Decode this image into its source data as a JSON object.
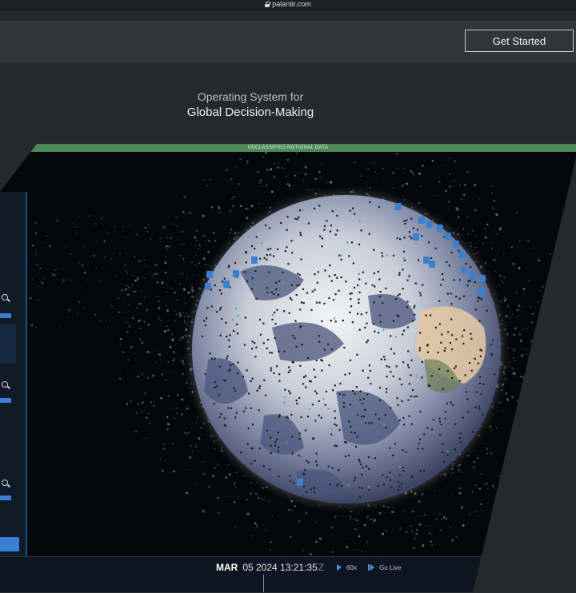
{
  "browser": {
    "url": "palantir.com",
    "lock_icon": "lock-icon"
  },
  "header": {
    "cta_label": "Get Started"
  },
  "hero": {
    "tagline_line1": "Operating System for",
    "tagline_line2": "Global Decision-Making"
  },
  "screen": {
    "classification": "UNCLASSIFIED NOTIONAL DATA",
    "classification_color": "#4f8a5a",
    "time": {
      "month": "MAR",
      "rest": "05 2024 13:21:35",
      "zone": "Z",
      "speed": "60x",
      "live_label": "Go Live"
    }
  },
  "colors": {
    "accent": "#3b7fd1",
    "background": "#25282c"
  }
}
